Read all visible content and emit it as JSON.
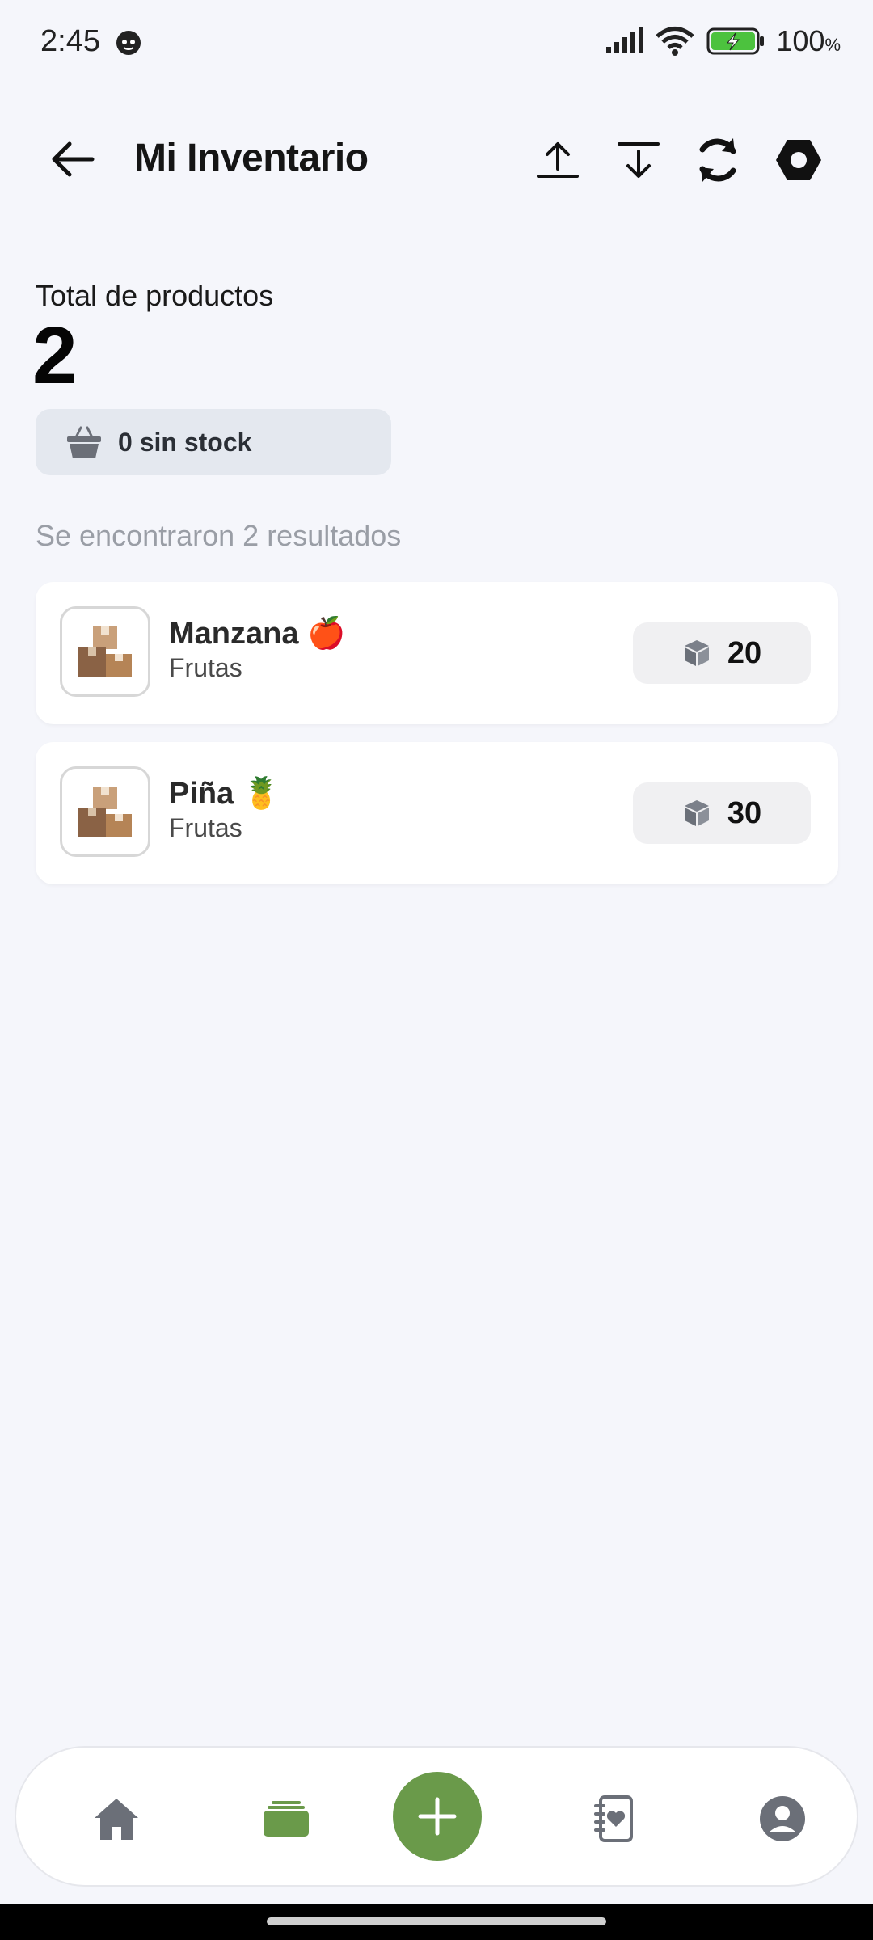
{
  "status_bar": {
    "time": "2:45",
    "battery": "100",
    "battery_unit": "%"
  },
  "header": {
    "title": "Mi Inventario",
    "icons": [
      "back-arrow-icon",
      "upload-icon",
      "download-icon",
      "sync-icon",
      "settings-hex-icon"
    ]
  },
  "summary": {
    "total_label": "Total de productos",
    "total_value": "2",
    "out_of_stock_label": "0 sin stock"
  },
  "results_text": "Se encontraron 2 resultados",
  "products": [
    {
      "name": "Manzana 🍎",
      "category": "Frutas",
      "quantity": "20"
    },
    {
      "name": "Piña 🍍",
      "category": "Frutas",
      "quantity": "30"
    }
  ],
  "bottom_nav": {
    "items": [
      "home-icon",
      "inventory-icon",
      "add-icon",
      "contacts-icon",
      "profile-icon"
    ],
    "active": "inventory-icon"
  },
  "colors": {
    "accent": "#6a9a4a",
    "background": "#f5f6fb",
    "chip": "#e4e8ef"
  }
}
